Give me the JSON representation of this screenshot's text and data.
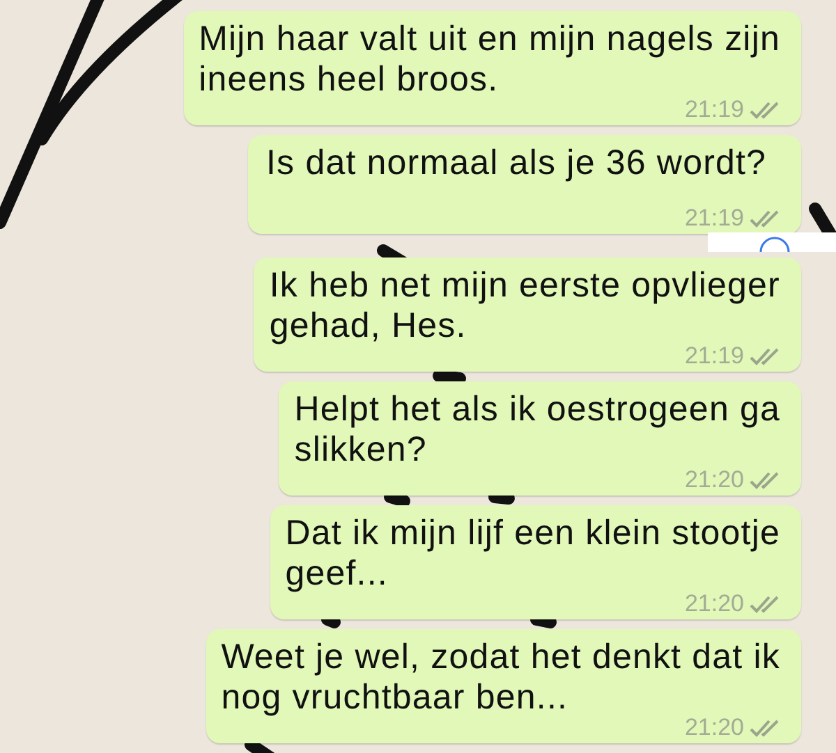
{
  "messages": [
    {
      "text": "Mijn haar valt uit en mijn nagels zijn\nineens heel broos.",
      "time": "21:19",
      "read": true
    },
    {
      "text": "Is dat normaal als je 36 wordt?",
      "time": "21:19",
      "read": true
    },
    {
      "text": "Ik heb net mijn eerste opvlieger\ngehad, Hes.",
      "time": "21:19",
      "read": true
    },
    {
      "text": "Helpt het als ik oestrogeen ga\nslikken?",
      "time": "21:20",
      "read": true
    },
    {
      "text": "Dat ik mijn lijf een klein stootje\ngeef...",
      "time": "21:20",
      "read": true
    },
    {
      "text": "Weet je wel, zodat het denkt dat ik\nnog vruchtbaar ben...",
      "time": "21:20",
      "read": true
    }
  ]
}
